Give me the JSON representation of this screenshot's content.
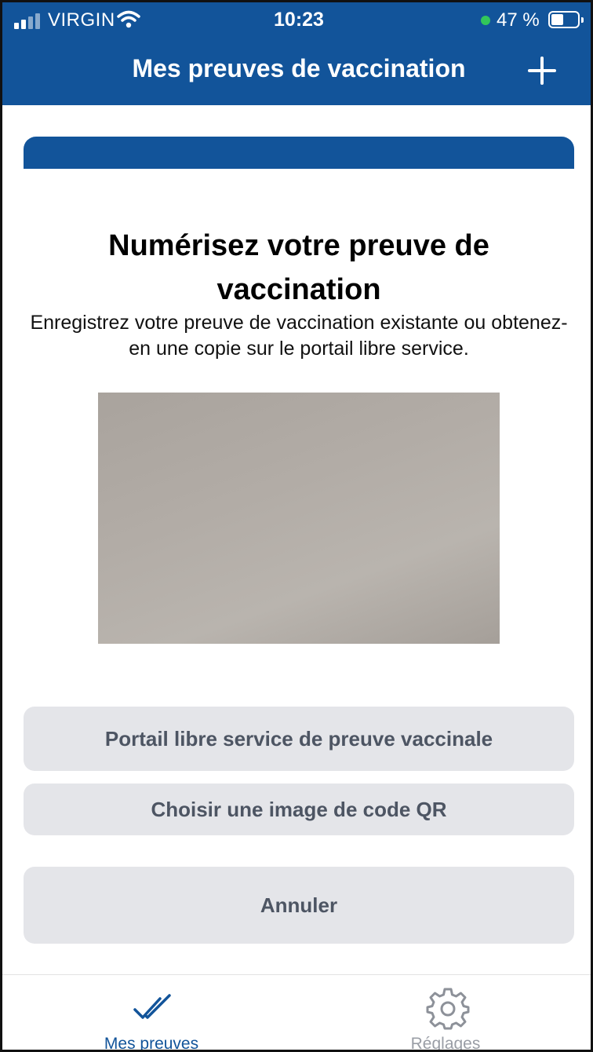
{
  "status_bar": {
    "carrier": "VIRGIN",
    "time": "10:23",
    "battery": "47 %",
    "battery_level": 0.47
  },
  "header": {
    "title": "Mes preuves de vaccination",
    "add_icon": "plus-icon"
  },
  "sheet": {
    "title": "Numérisez votre preuve de vaccination",
    "description": "Enregistrez votre preuve de vaccination existante ou obtenez-en une copie sur le portail libre service.",
    "buttons": {
      "portal": "Portail libre service de preuve vaccinale",
      "qr_image": "Choisir une image de code QR",
      "cancel": "Annuler"
    }
  },
  "tabbar": {
    "items": [
      {
        "label": "Mes preuves",
        "icon": "double-check-icon",
        "active": true
      },
      {
        "label": "Réglages",
        "icon": "gear-icon",
        "active": false
      }
    ]
  },
  "colors": {
    "primary": "#12549a",
    "button_bg": "#e4e5e9",
    "button_text": "#4d5563",
    "inactive_tab": "#9a9ea6",
    "battery_dot": "#32c75a"
  }
}
